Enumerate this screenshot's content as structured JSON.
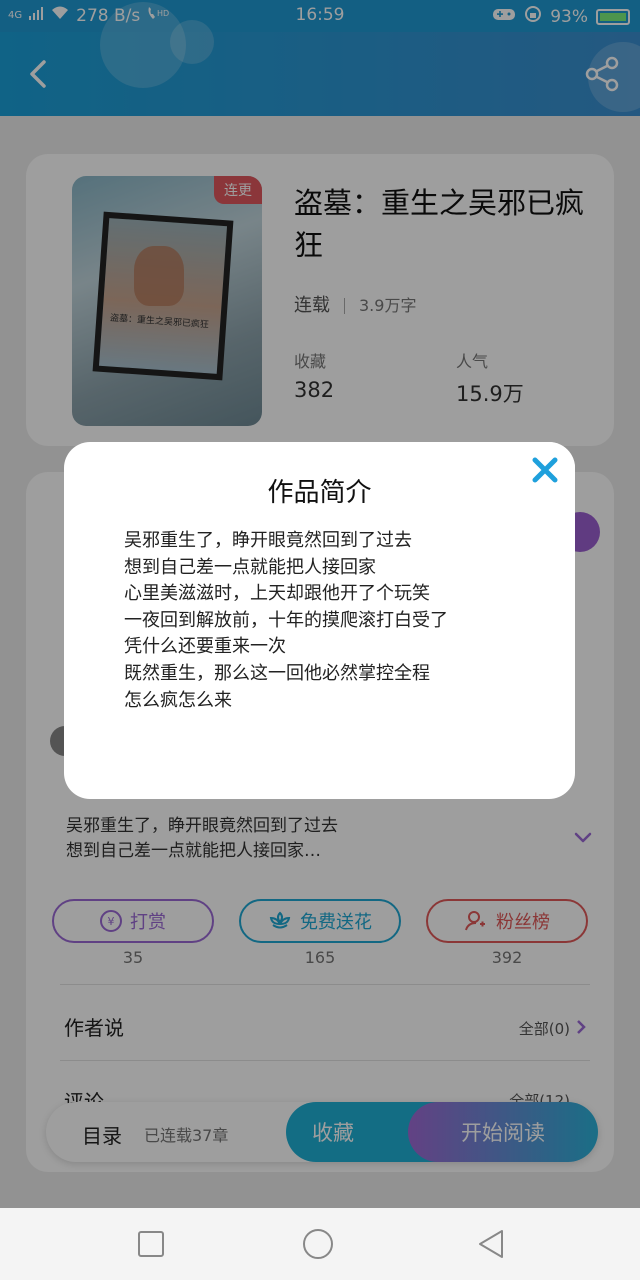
{
  "status_bar": {
    "network": "4G",
    "speed": "278 B/s",
    "time": "16:59",
    "battery": "93%"
  },
  "book": {
    "tag": "连更",
    "cover_text": "盗墓：重生之吴邪已疯狂",
    "title": "盗墓：重生之吴邪已疯狂",
    "status": "连载",
    "word_count": "3.9万字",
    "favorites_label": "收藏",
    "favorites": "382",
    "popularity_label": "人气",
    "popularity": "15.9万"
  },
  "synopsis_preview": [
    "吴邪重生了，睁开眼竟然回到了过去",
    "想到自己差一点就能把人接回家…"
  ],
  "actions": [
    {
      "label": "打赏",
      "count": "35",
      "color": "#9b6ad6"
    },
    {
      "label": "免费送花",
      "count": "165",
      "color": "#1fa8d4"
    },
    {
      "label": "粉丝榜",
      "count": "392",
      "color": "#e05a5a"
    }
  ],
  "author_says": {
    "title": "作者说",
    "right": "全部(0)"
  },
  "comments": {
    "title": "评论",
    "right": "全部(12)"
  },
  "bottom_bar": {
    "toc": "目录",
    "serial": "已连载37章",
    "favorite": "收藏",
    "start_reading": "开始阅读"
  },
  "modal": {
    "title": "作品简介",
    "lines": [
      "吴邪重生了，睁开眼竟然回到了过去",
      "想到自己差一点就能把人接回家",
      "心里美滋滋时，上天却跟他开了个玩笑",
      "一夜回到解放前，十年的摸爬滚打白受了",
      "凭什么还要重来一次",
      "既然重生，那么这一回他必然掌控全程",
      "怎么疯怎么来"
    ]
  }
}
